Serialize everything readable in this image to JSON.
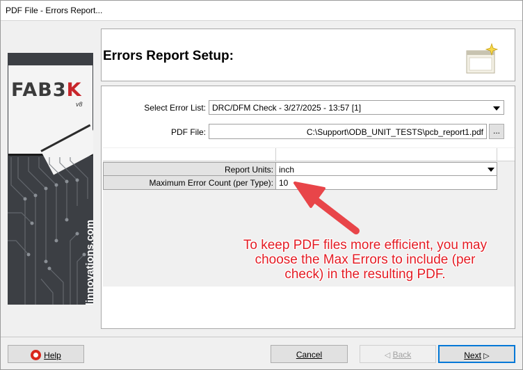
{
  "window": {
    "title": "PDF File - Errors Report..."
  },
  "banner": {
    "logo_main": "FAB3",
    "logo_k": "K",
    "logo_version": "v8",
    "vertical_text": "numericalinnovations.com"
  },
  "header": {
    "title": "Errors Report Setup:",
    "icon": "wizard-window-sparkle-icon"
  },
  "form": {
    "error_list_label": "Select Error List:",
    "error_list_value": "DRC/DFM Check - 3/27/2025 - 13:57 [1]",
    "pdf_file_label": "PDF File:",
    "pdf_file_value": "C:\\Support\\ODB_UNIT_TESTS\\pcb_report1.pdf",
    "browse_label": "..."
  },
  "grid": {
    "rows": [
      {
        "key": "Report Units:",
        "value": "inch"
      },
      {
        "key": "Maximum Error Count (per Type):",
        "value": "10"
      }
    ]
  },
  "annotation": {
    "lines": [
      "To keep PDF files more efficient, you may",
      "choose the Max Errors to include (per",
      "check) in the resulting PDF."
    ],
    "color": "#e31b23"
  },
  "buttons": {
    "help": "Help",
    "cancel": "Cancel",
    "back": "Back",
    "next": "Next"
  },
  "colors": {
    "accent": "#0078d7",
    "arrow": "#e84549",
    "logo_red": "#c8262b"
  }
}
